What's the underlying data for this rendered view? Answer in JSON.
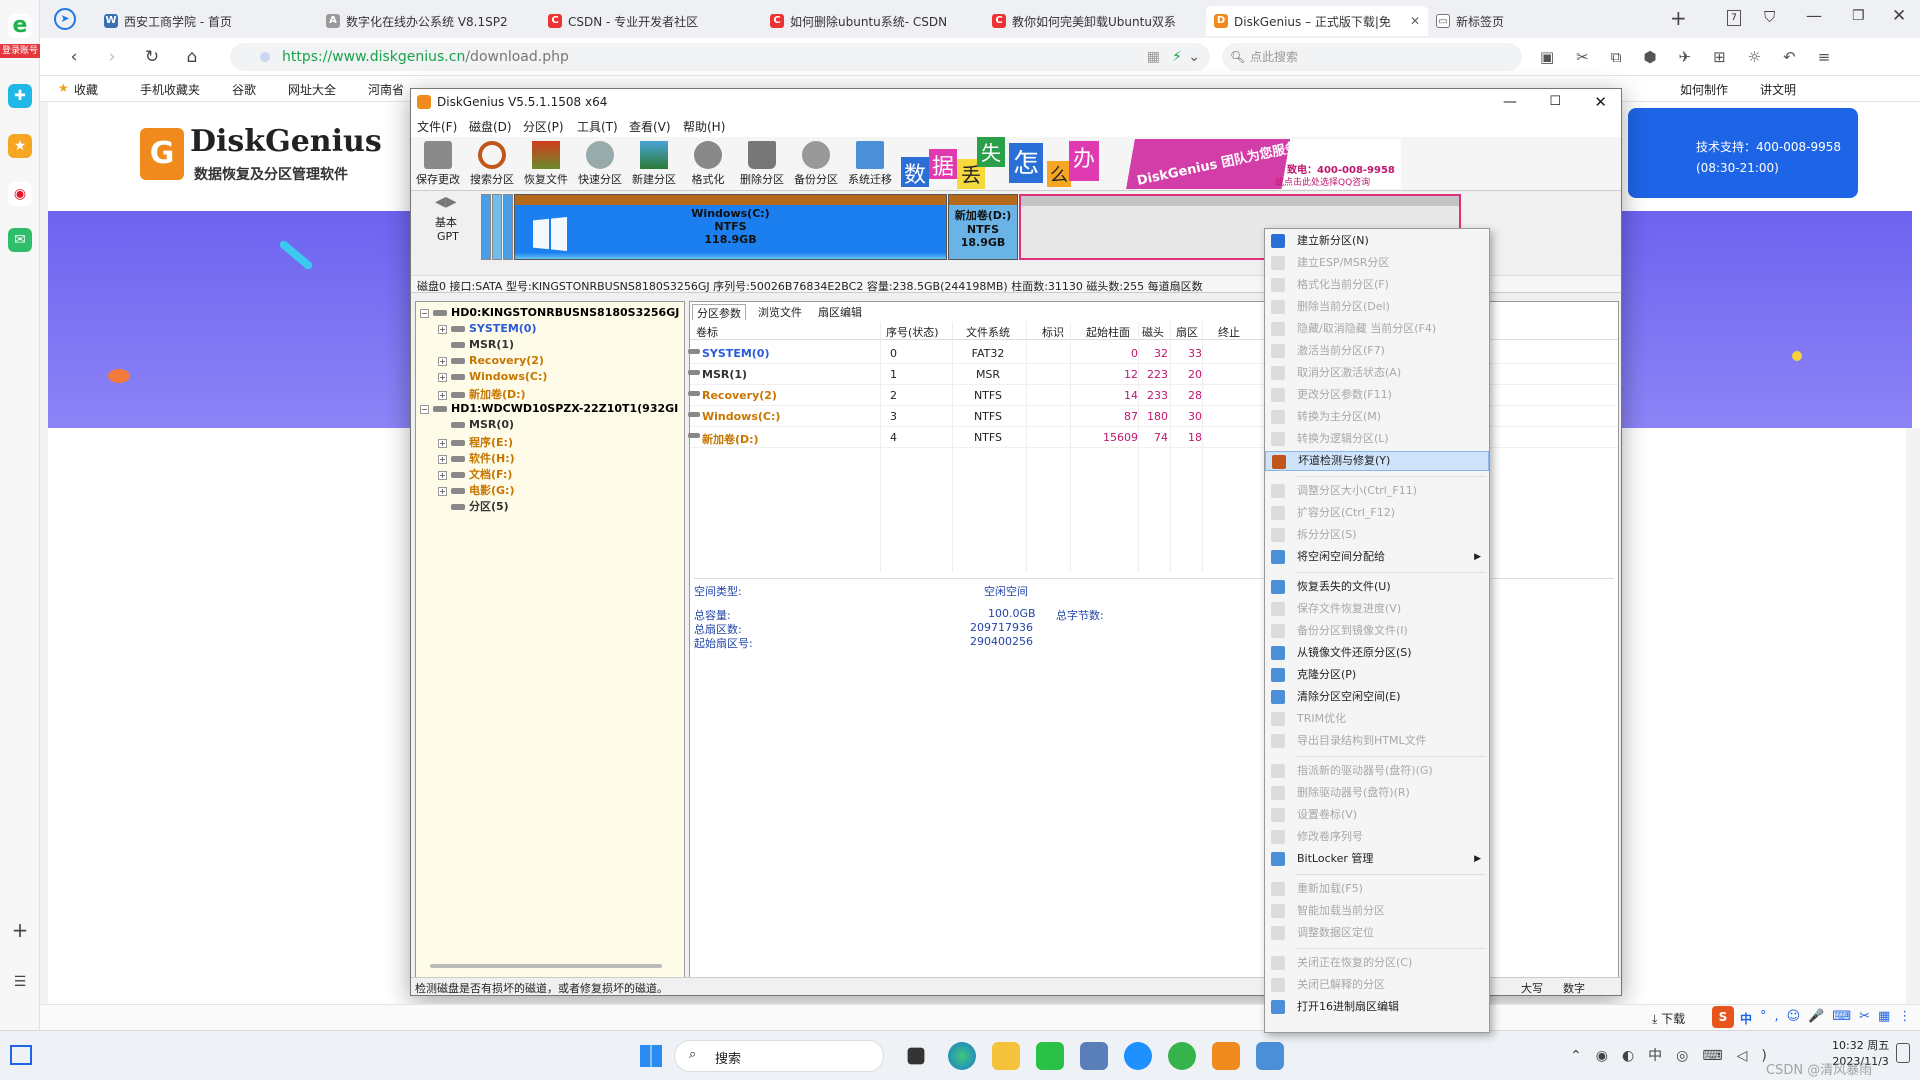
{
  "browser": {
    "login_badge": "登录账号",
    "tabs": [
      {
        "label": "西安工商学院 - 首页"
      },
      {
        "label": "数字化在线办公系统 V8.1SP2"
      },
      {
        "label": "CSDN - 专业开发者社区"
      },
      {
        "label": "如何删除ubuntu系统- CSDN"
      },
      {
        "label": "教你如何完美卸载Ubuntu双系"
      },
      {
        "label": "DiskGenius – 正式版下载|免"
      },
      {
        "label": "新标签页"
      }
    ],
    "url_scheme": "https://",
    "url_host": "www.diskgenius.cn",
    "url_path": "/download.php",
    "search_placeholder": "点此搜索",
    "bookmarks": [
      "收藏",
      "手机收藏夹",
      "谷歌",
      "网址大全",
      "河南省",
      "如何制作",
      "讲文明"
    ]
  },
  "site": {
    "logo_name": "DiskGenius",
    "logo_reg": "®",
    "logo_sub": "数据恢复及分区管理软件",
    "support_line": "技术支持：400-008-9958",
    "support_hours": "(08:30-21:00)"
  },
  "dg": {
    "title": "DiskGenius V5.5.1.1508 x64",
    "menu": [
      "文件(F)",
      "磁盘(D)",
      "分区(P)",
      "工具(T)",
      "查看(V)",
      "帮助(H)"
    ],
    "toolbar": [
      "保存更改",
      "搜索分区",
      "恢复文件",
      "快速分区",
      "新建分区",
      "格式化",
      "删除分区",
      "备份分区",
      "系统迁移"
    ],
    "ad": {
      "chars": [
        "数",
        "据",
        "丢",
        "失",
        "怎",
        "么",
        "办"
      ],
      "slogan": "DiskGenius 团队为您服务",
      "phone": "致电：400-008-9958",
      "qq": "或点击此处选择QQ咨询"
    },
    "disk_type": "基本",
    "disk_style": "GPT",
    "partitions_bar": [
      {
        "name": "Windows(C:)",
        "fs": "NTFS",
        "size": "118.9GB"
      },
      {
        "name": "新加卷(D:)",
        "fs": "NTFS",
        "size": "18.9GB"
      }
    ],
    "disk_info": "磁盘0 接口:SATA  型号:KINGSTONRBUSNS8180S3256GJ  序列号:50026B76834E2BC2  容量:238.5GB(244198MB)  柱面数:31130  磁头数:255  每道扇区数",
    "tree": [
      {
        "label": "HD0:KINGSTONRBUSNS8180S3256GJ",
        "level": 0,
        "color": "#000"
      },
      {
        "label": "SYSTEM(0)",
        "level": 1,
        "color": "#2a5bd7"
      },
      {
        "label": "MSR(1)",
        "level": 1,
        "color": "#333"
      },
      {
        "label": "Recovery(2)",
        "level": 1,
        "color": "#c77600"
      },
      {
        "label": "Windows(C:)",
        "level": 1,
        "color": "#c77600"
      },
      {
        "label": "新加卷(D:)",
        "level": 1,
        "color": "#c77600"
      },
      {
        "label": "HD1:WDCWD10SPZX-22Z10T1(932GI",
        "level": 0,
        "color": "#000"
      },
      {
        "label": "MSR(0)",
        "level": 1,
        "color": "#333"
      },
      {
        "label": "程序(E:)",
        "level": 1,
        "color": "#c77600"
      },
      {
        "label": "软件(H:)",
        "level": 1,
        "color": "#c77600"
      },
      {
        "label": "文档(F:)",
        "level": 1,
        "color": "#c77600"
      },
      {
        "label": "电影(G:)",
        "level": 1,
        "color": "#c77600"
      },
      {
        "label": "分区(5)",
        "level": 1,
        "color": "#333"
      }
    ],
    "subtabs": [
      "分区参数",
      "浏览文件",
      "扇区编辑"
    ],
    "columns": [
      "卷标",
      "序号(状态)",
      "文件系统",
      "标识",
      "起始柱面",
      "磁头",
      "扇区",
      "终止"
    ],
    "rows": [
      {
        "label": "SYSTEM(0)",
        "color": "#2a5bd7",
        "idx": "0",
        "fs": "FAT32",
        "cyl": "0",
        "head": "32",
        "sec": "33"
      },
      {
        "label": "MSR(1)",
        "color": "#333",
        "idx": "1",
        "fs": "MSR",
        "cyl": "12",
        "head": "223",
        "sec": "20"
      },
      {
        "label": "Recovery(2)",
        "color": "#c77600",
        "idx": "2",
        "fs": "NTFS",
        "cyl": "14",
        "head": "233",
        "sec": "28"
      },
      {
        "label": "Windows(C:)",
        "color": "#c77600",
        "idx": "3",
        "fs": "NTFS",
        "cyl": "87",
        "head": "180",
        "sec": "30"
      },
      {
        "label": "新加卷(D:)",
        "color": "#c77600",
        "idx": "4",
        "fs": "NTFS",
        "cyl": "15609",
        "head": "74",
        "sec": "18"
      }
    ],
    "free_info": {
      "type_label": "空间类型:",
      "type_value": "空闲空间",
      "total_label": "总容量:",
      "total_value": "100.0GB",
      "bytes_label": "总字节数:",
      "sectors_label": "总扇区数:",
      "sectors_value": "209717936",
      "start_label": "起始扇区号:",
      "start_value": "290400256"
    },
    "status_text": "检测磁盘是否有损坏的磁道，或者修复损坏的磁道。",
    "status_caps": "大写",
    "status_num": "数字"
  },
  "context_menu": [
    {
      "label": "建立新分区(N)",
      "enabled": true
    },
    {
      "label": "建立ESP/MSR分区",
      "enabled": false
    },
    {
      "label": "格式化当前分区(F)",
      "enabled": false
    },
    {
      "label": "删除当前分区(Del)",
      "enabled": false
    },
    {
      "label": "隐藏/取消隐藏 当前分区(F4)",
      "enabled": false
    },
    {
      "label": "激活当前分区(F7)",
      "enabled": false
    },
    {
      "label": "取消分区激活状态(A)",
      "enabled": false
    },
    {
      "label": "更改分区参数(F11)",
      "enabled": false
    },
    {
      "label": "转换为主分区(M)",
      "enabled": false
    },
    {
      "label": "转换为逻辑分区(L)",
      "enabled": false
    },
    {
      "label": "坏道检测与修复(Y)",
      "enabled": true,
      "highlight": true
    },
    {
      "sep": true
    },
    {
      "label": "调整分区大小(Ctrl_F11)",
      "enabled": false
    },
    {
      "label": "扩容分区(Ctrl_F12)",
      "enabled": false
    },
    {
      "label": "拆分分区(S)",
      "enabled": false
    },
    {
      "label": "将空闲空间分配给",
      "enabled": true,
      "submenu": true
    },
    {
      "sep": true
    },
    {
      "label": "恢复丢失的文件(U)",
      "enabled": true
    },
    {
      "label": "保存文件恢复进度(V)",
      "enabled": false
    },
    {
      "label": "备份分区到镜像文件(I)",
      "enabled": false
    },
    {
      "label": "从镜像文件还原分区(S)",
      "enabled": true
    },
    {
      "label": "克隆分区(P)",
      "enabled": true
    },
    {
      "label": "清除分区空闲空间(E)",
      "enabled": true
    },
    {
      "label": "TRIM优化",
      "enabled": false
    },
    {
      "label": "导出目录结构到HTML文件",
      "enabled": false
    },
    {
      "sep": true
    },
    {
      "label": "指派新的驱动器号(盘符)(G)",
      "enabled": false
    },
    {
      "label": "删除驱动器号(盘符)(R)",
      "enabled": false
    },
    {
      "label": "设置卷标(V)",
      "enabled": false
    },
    {
      "label": "修改卷序列号",
      "enabled": false
    },
    {
      "label": "BitLocker 管理",
      "enabled": true,
      "submenu": true
    },
    {
      "sep": true
    },
    {
      "label": "重新加载(F5)",
      "enabled": false
    },
    {
      "label": "智能加载当前分区",
      "enabled": false
    },
    {
      "label": "调整数据区定位",
      "enabled": false
    },
    {
      "sep": true
    },
    {
      "label": "关闭正在恢复的分区(C)",
      "enabled": false
    },
    {
      "label": "关闭已解释的分区",
      "enabled": false
    },
    {
      "label": "打开16进制扇区编辑",
      "enabled": true
    }
  ],
  "taskbar": {
    "search": "搜索",
    "download": "下载",
    "time": "10:32 周五",
    "date": "2023/11/3",
    "ime_lang": "中",
    "watermark": "CSDN @清风暴雨"
  }
}
